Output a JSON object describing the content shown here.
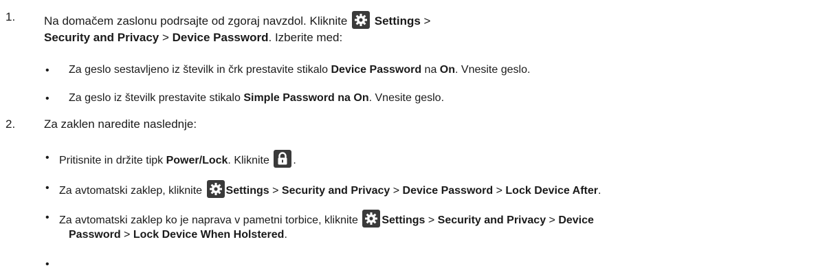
{
  "steps": [
    {
      "number": "1.",
      "line1": {
        "t1": "Na domačem zaslonu podrsajte od zgoraj navzdol. Kliknite ",
        "b1": "Settings",
        "t2": " >"
      },
      "line2": {
        "b1": "Security and Privacy",
        "t1": " > ",
        "b2": "Device Password",
        "t2": ". Izberite med:"
      },
      "bullets": [
        {
          "t1": "Za geslo sestavljeno iz številk in črk prestavite stikalo ",
          "b1": "Device Password",
          "t2": " na ",
          "b2": "On",
          "t3": ". Vnesite geslo."
        },
        {
          "t1": "Za geslo iz številk prestavite stikalo ",
          "b1": "Simple Password na",
          "t2": " ",
          "b2": "On",
          "t3": ". Vnesite geslo."
        }
      ]
    },
    {
      "number": "2.",
      "text": "Za zaklen naredite naslednje:",
      "bullets": [
        {
          "t1": "Pritisnite in držite tipk ",
          "b1": "Power/Lock",
          "t2": ". Kliknite ",
          "t3": "."
        },
        {
          "t1": "Za avtomatski zaklep, kliknite ",
          "b1": "Settings",
          "t2": " > ",
          "b2": "Security and Privacy",
          "t3": " > ",
          "b3": "Device Password",
          "t4": " > ",
          "b4": "Lock Device After",
          "t5": "."
        },
        {
          "t1": "Za avtomatski zaklep ko je naprava v pametni torbice, kliknite ",
          "b1": "Settings",
          "t2": " > ",
          "b2": "Security and Privacy",
          "t3": " > ",
          "b3": "Device",
          "b4": "Password",
          "t4": " > ",
          "b5": "Lock Device When Holstered",
          "t5": "."
        }
      ]
    }
  ],
  "bullet_char": "•",
  "icons": {
    "settings": "gear-icon",
    "lock": "lock-icon"
  }
}
